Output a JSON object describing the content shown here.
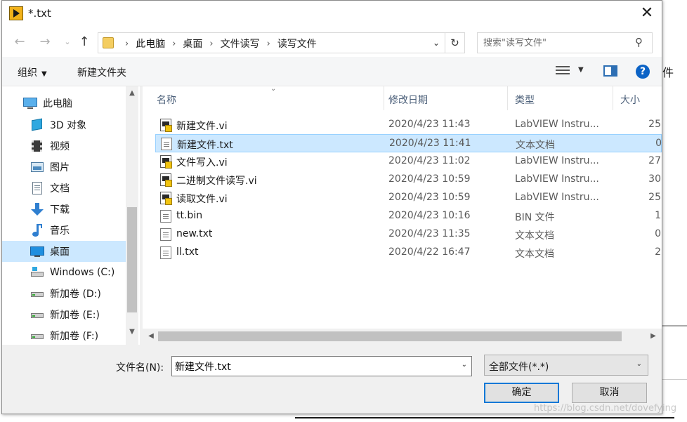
{
  "window": {
    "title": "*.txt",
    "close_glyph": "✕"
  },
  "address_bar": {
    "breadcrumbs": [
      "此电脑",
      "桌面",
      "文件读写",
      "读写文件"
    ],
    "separator": "›",
    "search_placeholder": "搜索\"读写文件\""
  },
  "toolbar": {
    "organize_label": "组织",
    "new_folder_label": "新建文件夹",
    "help_glyph": "?"
  },
  "nav_items": [
    {
      "label": "此电脑",
      "icon": "pc-icon"
    },
    {
      "label": "3D 对象",
      "icon": "cube-icon"
    },
    {
      "label": "视频",
      "icon": "video-icon"
    },
    {
      "label": "图片",
      "icon": "picture-icon"
    },
    {
      "label": "文档",
      "icon": "document-icon"
    },
    {
      "label": "下载",
      "icon": "download-icon"
    },
    {
      "label": "音乐",
      "icon": "music-icon"
    },
    {
      "label": "桌面",
      "icon": "desktop-icon",
      "selected": true
    },
    {
      "label": "Windows   (C:)",
      "icon": "drive-icon"
    },
    {
      "label": "新加卷 (D:)",
      "icon": "drive-icon"
    },
    {
      "label": "新加卷 (E:)",
      "icon": "drive-icon"
    },
    {
      "label": "新加卷 (F:)",
      "icon": "drive-icon"
    }
  ],
  "columns": {
    "name": "名称",
    "date": "修改日期",
    "type": "类型",
    "size": "大小"
  },
  "files": [
    {
      "name": "新建文件.vi",
      "date": "2020/4/23 11:43",
      "type": "LabVIEW Instru...",
      "size": "25",
      "icon": "vi-file-icon"
    },
    {
      "name": "新建文件.txt",
      "date": "2020/4/23 11:41",
      "type": "文本文档",
      "size": "0",
      "icon": "text-file-icon",
      "selected": true
    },
    {
      "name": "文件写入.vi",
      "date": "2020/4/23 11:02",
      "type": "LabVIEW Instru...",
      "size": "27",
      "icon": "vi-file-icon"
    },
    {
      "name": "二进制文件读写.vi",
      "date": "2020/4/23 10:59",
      "type": "LabVIEW Instru...",
      "size": "30",
      "icon": "vi-file-icon"
    },
    {
      "name": "读取文件.vi",
      "date": "2020/4/23 10:59",
      "type": "LabVIEW Instru...",
      "size": "25",
      "icon": "vi-file-icon"
    },
    {
      "name": "tt.bin",
      "date": "2020/4/23 10:16",
      "type": "BIN 文件",
      "size": "1",
      "icon": "generic-file-icon"
    },
    {
      "name": "new.txt",
      "date": "2020/4/23 11:35",
      "type": "文本文档",
      "size": "0",
      "icon": "text-file-icon"
    },
    {
      "name": "ll.txt",
      "date": "2020/4/22 16:47",
      "type": "文本文档",
      "size": "2",
      "icon": "text-file-icon"
    }
  ],
  "footer": {
    "filename_label": "文件名(N):",
    "filename_value": "新建文件.txt",
    "filetype_value": "全部文件(*.*)",
    "ok_label": "确定",
    "cancel_label": "取消"
  },
  "background": {
    "cut_text": "件"
  },
  "watermark": "https://blog.csdn.net/dovefying",
  "colors": {
    "selection": "#cce8ff",
    "accent": "#0078d7",
    "header_text": "#4c607a"
  }
}
